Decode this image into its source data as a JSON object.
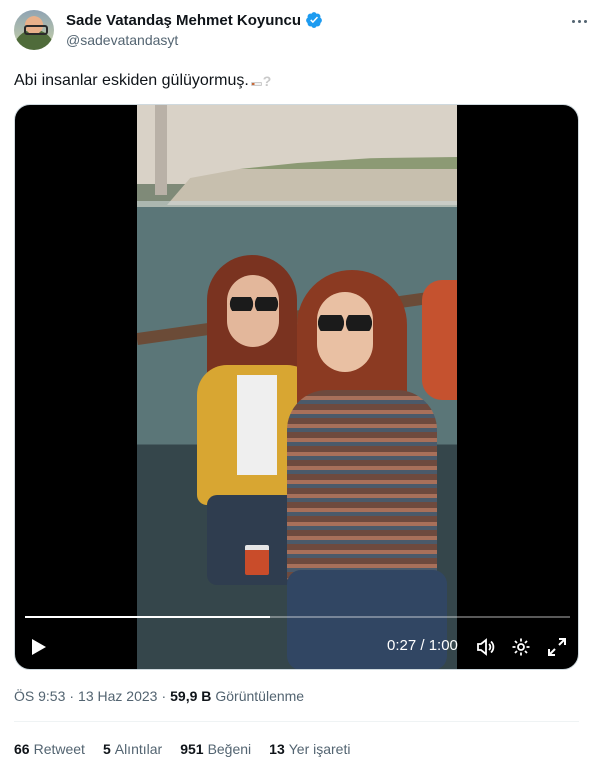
{
  "author": {
    "display_name": "Sade Vatandaş Mehmet Koyuncu",
    "handle": "@sadevatandasyt",
    "verified": true,
    "avatar_icon": "user-avatar"
  },
  "menu_icon": "more-horizontal-icon",
  "tweet": {
    "text": "Abi insanlar eskiden gülüyormuş.",
    "emoji_names": [
      "cigarette-emoji",
      "white-question-mark-emoji"
    ]
  },
  "video": {
    "current_time": "0:27",
    "duration": "1:00",
    "time_display": "0:27 / 1:00",
    "progress_fraction": 0.45,
    "controls": [
      "play-icon",
      "volume-icon",
      "settings-icon",
      "fullscreen-icon"
    ]
  },
  "meta": {
    "time": "ÖS 9:53",
    "date": "13 Haz 2023",
    "views_count": "59,9 B",
    "views_label": "Görüntülenme"
  },
  "stats": [
    {
      "count": "66",
      "label": "Retweet"
    },
    {
      "count": "5",
      "label": "Alıntılar"
    },
    {
      "count": "951",
      "label": "Beğeni"
    },
    {
      "count": "13",
      "label": "Yer işareti"
    }
  ],
  "colors": {
    "verified_blue": "#1d9bf0",
    "text_primary": "#0f1419",
    "text_secondary": "#536471",
    "divider": "#eff3f4"
  }
}
